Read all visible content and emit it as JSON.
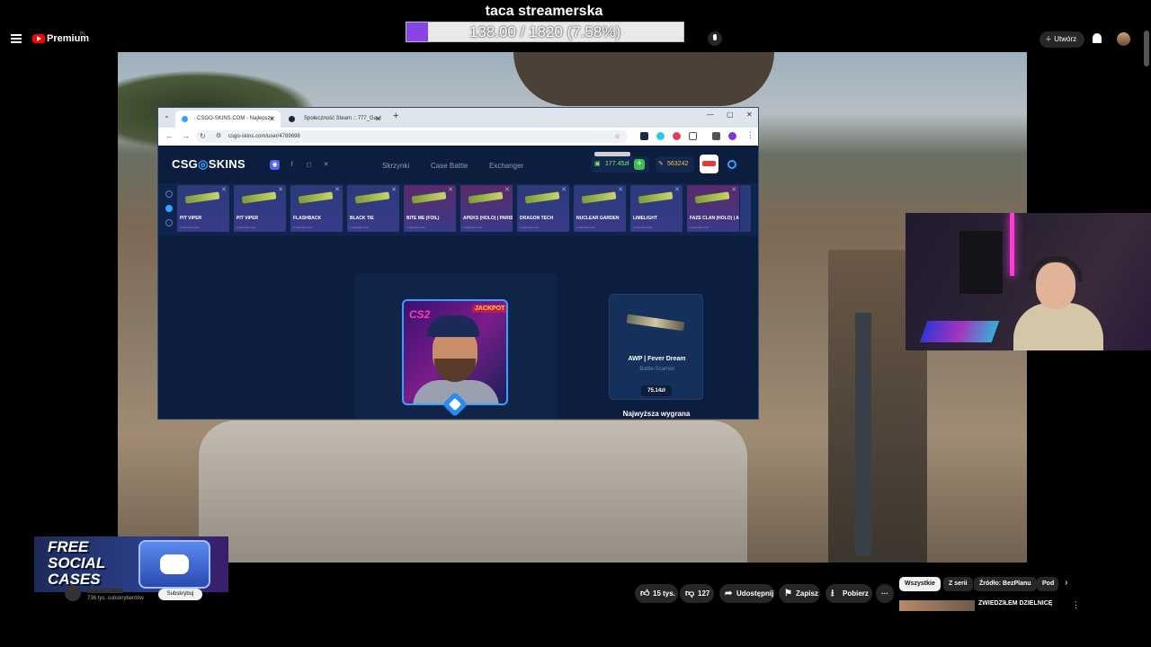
{
  "overlay": {
    "goal_title": "taca streamerska",
    "goal_text": "138.00 / 1820 (7.58%)",
    "goal_progress": 0.0758,
    "goal_color": "#8a44e6"
  },
  "yt_header": {
    "brand": "Premium",
    "region": "PL",
    "create_label": "Utwórz",
    "icons": [
      "menu-icon",
      "youtube-logo",
      "search-icon",
      "mic-icon",
      "bell-icon"
    ]
  },
  "browser": {
    "tabs": [
      {
        "title": "CSGO-SKINS.COM - Najlepsze",
        "favicon_color": "#3aa0ff"
      },
      {
        "title": "Społeczność Steam :: 777_Gaul",
        "favicon_color": "#1b2838"
      }
    ],
    "new_tab": "+",
    "url": "csgo-skins.com/user/4789698"
  },
  "site": {
    "logo_prefix": "CSG",
    "logo_suffix": "SKINS",
    "nav": [
      "Skrzynki",
      "Case Battle",
      "Exchanger"
    ],
    "balance": "177.45zł",
    "points": "563242",
    "accent": "#3aa0ff"
  },
  "drops": [
    {
      "name": "PIT VIPER",
      "sub": "2 sekundy temu"
    },
    {
      "name": "PIT VIPER",
      "sub": "2 sekundy temu"
    },
    {
      "name": "FLASHBACK",
      "sub": "2 sekundy temu"
    },
    {
      "name": "BLACK TIE",
      "sub": "2 sekundy temu"
    },
    {
      "name": "BITE ME (FOIL)",
      "sub": "2 sekundy temu"
    },
    {
      "name": "APEKS (HOLO) | PARIS 2023",
      "sub": "2 sekundy temu"
    },
    {
      "name": "DRAGON TECH",
      "sub": "2 sekundy temu"
    },
    {
      "name": "NUCLEAR GARDEN",
      "sub": "2 sekundy temu"
    },
    {
      "name": "LIMELIGHT",
      "sub": "2 sekundy temu"
    },
    {
      "name": "FAZE CLAN (HOLO) | ANTWERP 2022",
      "sub": "2 sekundy temu"
    }
  ],
  "profile": {
    "pic_text": "CS2",
    "pic_badge": "JACKPOT"
  },
  "best_drop": {
    "name": "AWP | Fever Dream",
    "condition": "Battle-Scarred",
    "price": "75.14zł",
    "label": "Najwyższa wygrana"
  },
  "promo": {
    "line1": "FREE",
    "line2": "SOCIAL",
    "line3": "CASES"
  },
  "channel": {
    "subs": "736 tys. subskrybentów",
    "subscribe_label": "Subskrybuj"
  },
  "actions": {
    "likes": "15 tys.",
    "dislikes": "127",
    "share": "Udostępnij",
    "save": "Zapisz",
    "download": "Pobierz",
    "more": "···"
  },
  "chips": {
    "all": "Wszystkie",
    "series": "Z serii",
    "source": "Źródło: BezPlanu",
    "more": "Pod"
  },
  "recommendation": {
    "title": "ZWIEDZIŁEM DZIELNICĘ"
  }
}
